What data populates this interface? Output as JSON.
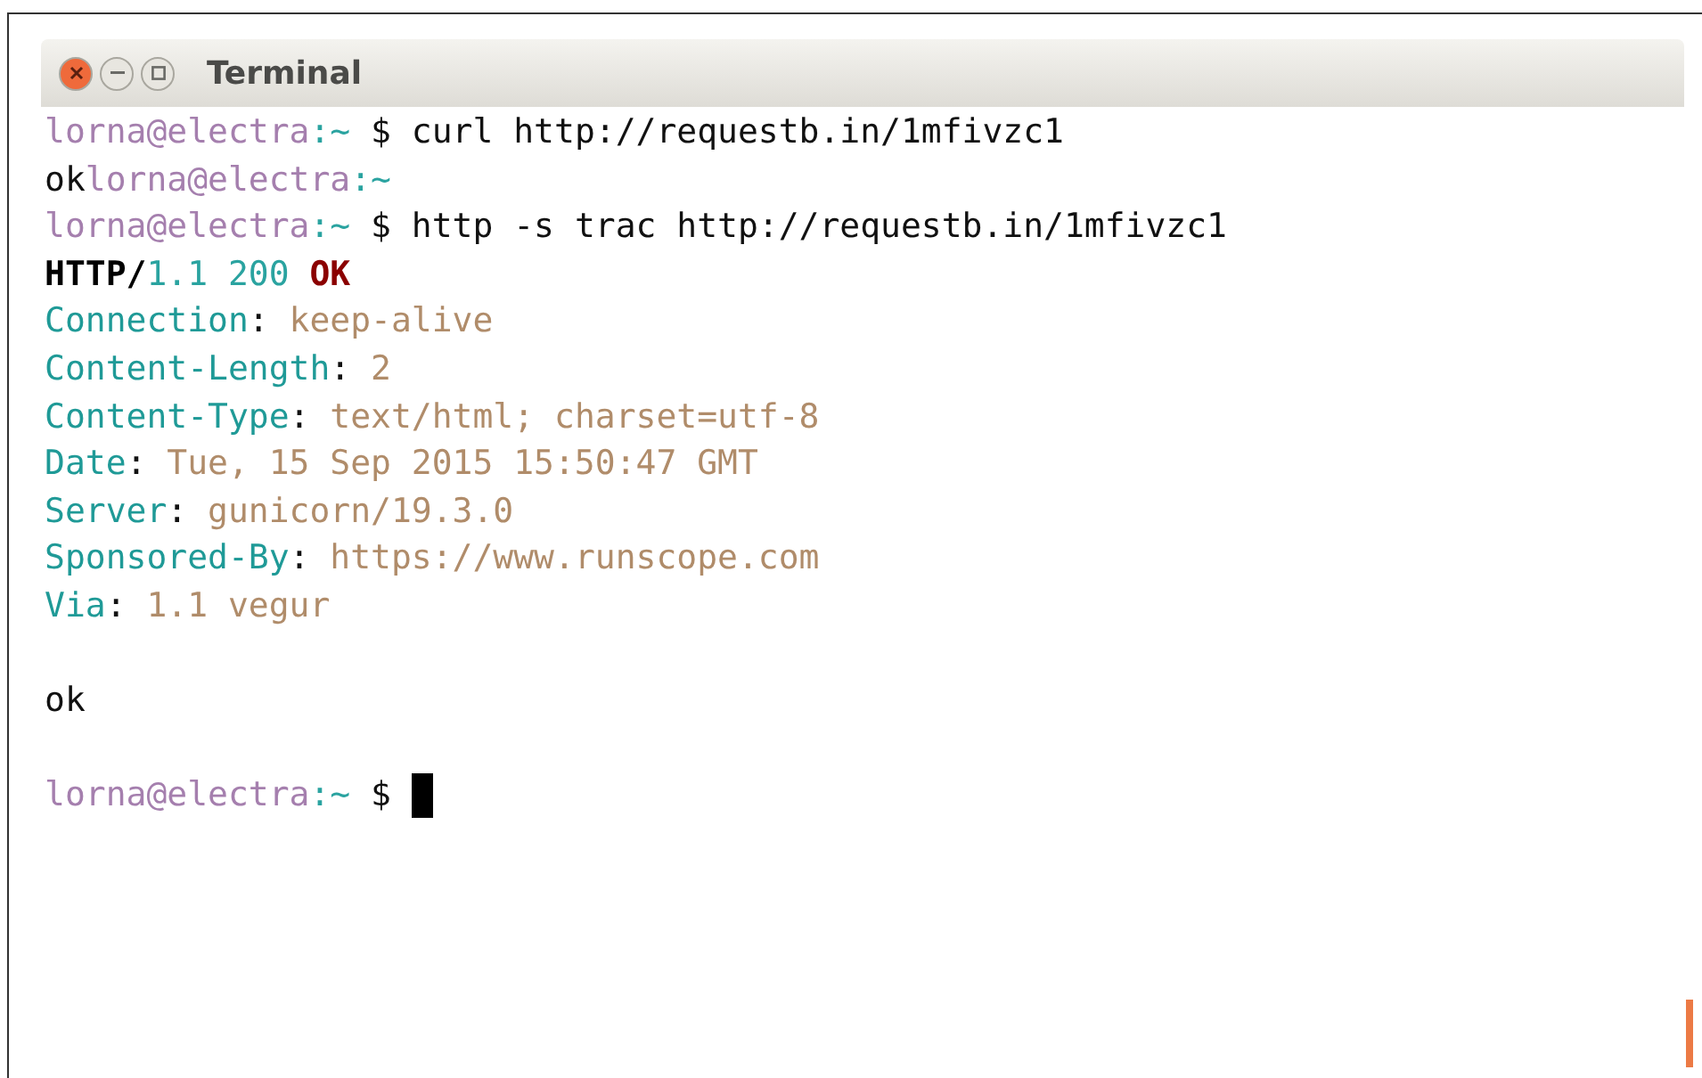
{
  "window": {
    "title": "Terminal"
  },
  "lines": [
    {
      "kind": "text",
      "segments": [
        {
          "kind": "user",
          "text": "lorna@electra"
        },
        {
          "kind": "path",
          "text": ":~"
        },
        {
          "kind": "plain",
          "text": " $ curl http://requestb.in/1mfivzc1"
        }
      ]
    },
    {
      "kind": "text",
      "segments": [
        {
          "kind": "plain",
          "text": "ok"
        },
        {
          "kind": "user",
          "text": "lorna@electra"
        },
        {
          "kind": "path",
          "text": ":~"
        }
      ]
    },
    {
      "kind": "text",
      "segments": [
        {
          "kind": "user",
          "text": "lorna@electra"
        },
        {
          "kind": "path",
          "text": ":~"
        },
        {
          "kind": "plain",
          "text": " $ http -s trac http://requestb.in/1mfivzc1"
        }
      ]
    },
    {
      "kind": "text",
      "segments": [
        {
          "kind": "bold",
          "text": "HTTP/"
        },
        {
          "kind": "path",
          "text": "1.1 200 "
        },
        {
          "kind": "status",
          "text": "OK"
        }
      ]
    },
    {
      "kind": "text",
      "segments": [
        {
          "kind": "header",
          "text": "Connection"
        },
        {
          "kind": "plain",
          "text": ": "
        },
        {
          "kind": "value",
          "text": "keep-alive"
        }
      ]
    },
    {
      "kind": "text",
      "segments": [
        {
          "kind": "header",
          "text": "Content-Length"
        },
        {
          "kind": "plain",
          "text": ": "
        },
        {
          "kind": "value",
          "text": "2"
        }
      ]
    },
    {
      "kind": "text",
      "segments": [
        {
          "kind": "header",
          "text": "Content-Type"
        },
        {
          "kind": "plain",
          "text": ": "
        },
        {
          "kind": "value",
          "text": "text/html; charset=utf-8"
        }
      ]
    },
    {
      "kind": "text",
      "segments": [
        {
          "kind": "header",
          "text": "Date"
        },
        {
          "kind": "plain",
          "text": ": "
        },
        {
          "kind": "value",
          "text": "Tue, 15 Sep 2015 15:50:47 GMT"
        }
      ]
    },
    {
      "kind": "text",
      "segments": [
        {
          "kind": "header",
          "text": "Server"
        },
        {
          "kind": "plain",
          "text": ": "
        },
        {
          "kind": "value",
          "text": "gunicorn/19.3.0"
        }
      ]
    },
    {
      "kind": "text",
      "segments": [
        {
          "kind": "header",
          "text": "Sponsored-By"
        },
        {
          "kind": "plain",
          "text": ": "
        },
        {
          "kind": "value",
          "text": "https://www.runscope.com"
        }
      ]
    },
    {
      "kind": "text",
      "segments": [
        {
          "kind": "header",
          "text": "Via"
        },
        {
          "kind": "plain",
          "text": ": "
        },
        {
          "kind": "value",
          "text": "1.1 vegur"
        }
      ]
    },
    {
      "kind": "blank"
    },
    {
      "kind": "text",
      "segments": [
        {
          "kind": "plain",
          "text": "ok"
        }
      ]
    },
    {
      "kind": "blank"
    },
    {
      "kind": "prompt",
      "segments": [
        {
          "kind": "user",
          "text": "lorna@electra"
        },
        {
          "kind": "path",
          "text": ":~"
        },
        {
          "kind": "plain",
          "text": " $ "
        }
      ]
    }
  ]
}
